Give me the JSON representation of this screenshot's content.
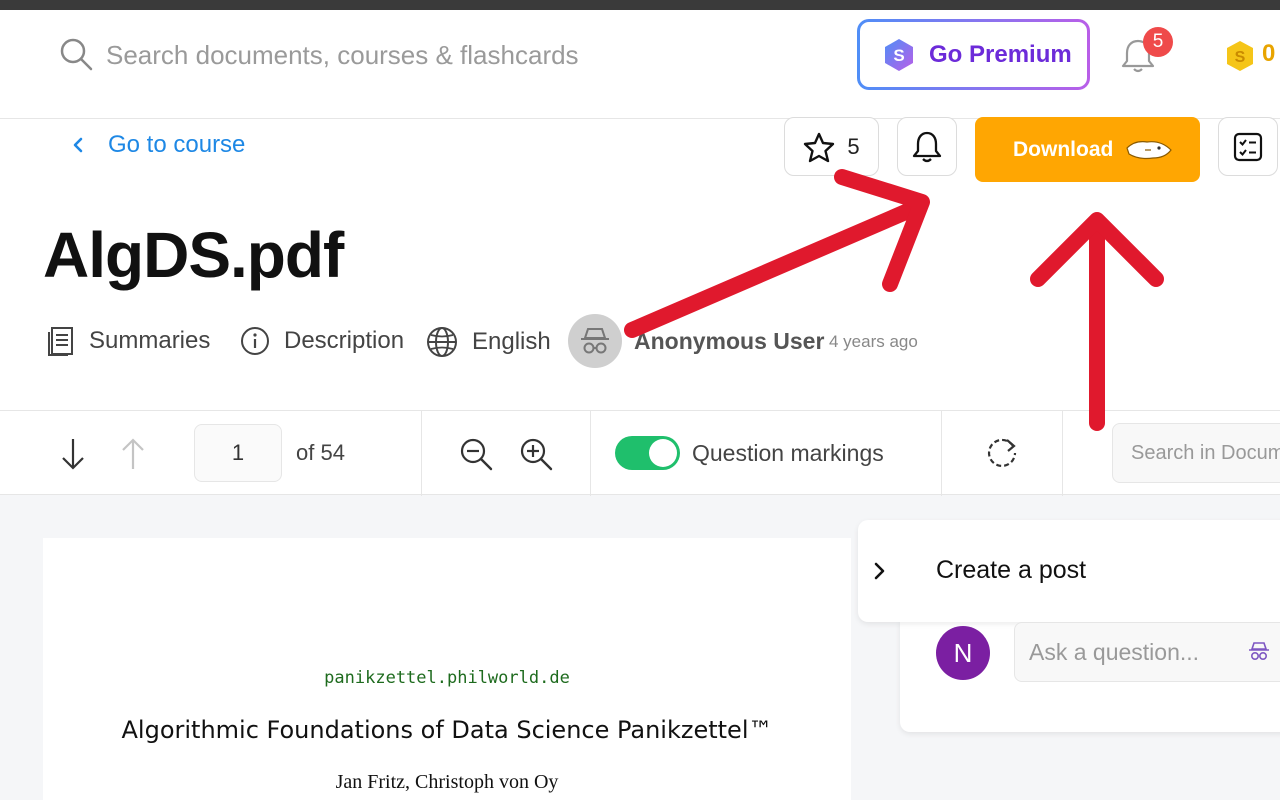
{
  "header": {
    "search_placeholder": "Search documents, courses & flashcards",
    "premium_label": "Go Premium",
    "notification_count": "5",
    "coin_count": "0"
  },
  "document": {
    "back_label": "Go to course",
    "star_count": "5",
    "download_label": "Download",
    "title": "AlgDS.pdf",
    "meta": {
      "summaries": "Summaries",
      "description": "Description",
      "language": "English",
      "author": "Anonymous User",
      "time": "4 years ago"
    }
  },
  "toolbar": {
    "page_current": "1",
    "page_of": "of  54",
    "question_markings_label": "Question markings",
    "question_markings_on": true,
    "search_placeholder": "Search in Document"
  },
  "pdf": {
    "url": "panikzettel.philworld.de",
    "title": "Algorithmic Foundations of Data Science Panikzettel™",
    "authors": "Jan Fritz, Christoph von Oy"
  },
  "post": {
    "title": "Create a post",
    "avatar_initial": "N",
    "ask_placeholder": "Ask a question..."
  },
  "colors": {
    "download": "#ffa602",
    "premium_text": "#6c2bd9",
    "link": "#1e88e5",
    "toggle": "#1fbf6c",
    "annotation_arrow": "#e0192d"
  }
}
